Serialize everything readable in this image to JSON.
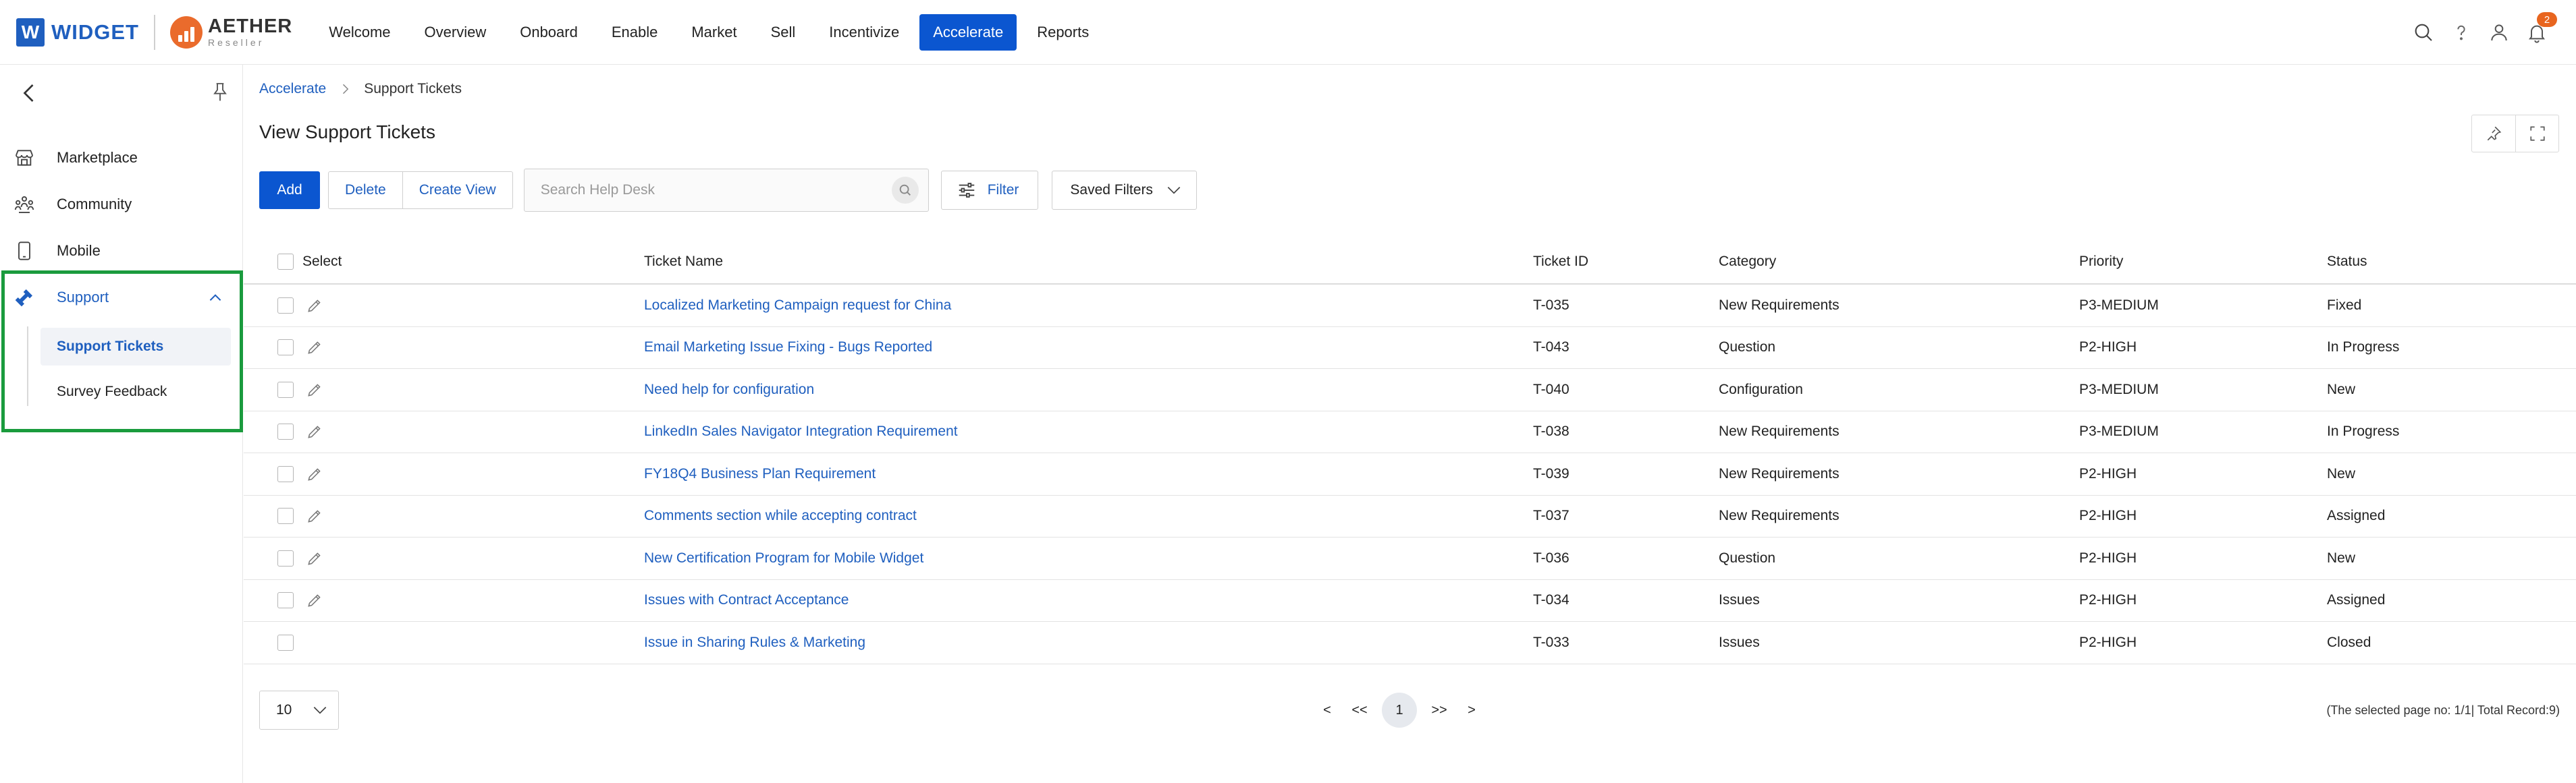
{
  "brand": {
    "widget_letter": "W",
    "widget_name": "WIDGET",
    "aether_name": "AETHER",
    "aether_sub": "Reseller"
  },
  "nav": {
    "items": [
      {
        "label": "Welcome",
        "active": false
      },
      {
        "label": "Overview",
        "active": false
      },
      {
        "label": "Onboard",
        "active": false
      },
      {
        "label": "Enable",
        "active": false
      },
      {
        "label": "Market",
        "active": false
      },
      {
        "label": "Sell",
        "active": false
      },
      {
        "label": "Incentivize",
        "active": false
      },
      {
        "label": "Accelerate",
        "active": true
      },
      {
        "label": "Reports",
        "active": false
      }
    ],
    "notification_count": "2"
  },
  "sidebar": {
    "items": [
      {
        "label": "Marketplace",
        "icon": "store-icon"
      },
      {
        "label": "Community",
        "icon": "community-icon"
      },
      {
        "label": "Mobile",
        "icon": "mobile-icon"
      },
      {
        "label": "Support",
        "icon": "support-icon"
      }
    ],
    "subitems": [
      {
        "label": "Support Tickets",
        "active": true
      },
      {
        "label": "Survey Feedback",
        "active": false
      }
    ]
  },
  "breadcrumb": {
    "parent": "Accelerate",
    "current": "Support Tickets"
  },
  "page": {
    "title": "View Support Tickets"
  },
  "toolbar": {
    "add_label": "Add",
    "delete_label": "Delete",
    "create_view_label": "Create View",
    "search_placeholder": "Search Help Desk",
    "filter_label": "Filter",
    "saved_filters_label": "Saved Filters"
  },
  "table": {
    "headers": {
      "select": "Select",
      "name": "Ticket Name",
      "id": "Ticket ID",
      "category": "Category",
      "priority": "Priority",
      "status": "Status"
    },
    "rows": [
      {
        "name": "Localized Marketing Campaign request for China",
        "id": "T-035",
        "category": "New Requirements",
        "priority": "P3-MEDIUM",
        "status": "Fixed",
        "editable": true
      },
      {
        "name": "Email Marketing Issue Fixing - Bugs Reported",
        "id": "T-043",
        "category": "Question",
        "priority": "P2-HIGH",
        "status": "In Progress",
        "editable": true
      },
      {
        "name": "Need help for configuration",
        "id": "T-040",
        "category": "Configuration",
        "priority": "P3-MEDIUM",
        "status": "New",
        "editable": true
      },
      {
        "name": "LinkedIn Sales Navigator Integration Requirement",
        "id": "T-038",
        "category": "New Requirements",
        "priority": "P3-MEDIUM",
        "status": "In Progress",
        "editable": true
      },
      {
        "name": "FY18Q4 Business Plan Requirement",
        "id": "T-039",
        "category": "New Requirements",
        "priority": "P2-HIGH",
        "status": "New",
        "editable": true
      },
      {
        "name": "Comments section while accepting contract",
        "id": "T-037",
        "category": "New Requirements",
        "priority": "P2-HIGH",
        "status": "Assigned",
        "editable": true
      },
      {
        "name": "New Certification Program for Mobile Widget",
        "id": "T-036",
        "category": "Question",
        "priority": "P2-HIGH",
        "status": "New",
        "editable": true
      },
      {
        "name": "Issues with Contract Acceptance",
        "id": "T-034",
        "category": "Issues",
        "priority": "P2-HIGH",
        "status": "Assigned",
        "editable": true
      },
      {
        "name": "Issue in Sharing Rules & Marketing",
        "id": "T-033",
        "category": "Issues",
        "priority": "P2-HIGH",
        "status": "Closed",
        "editable": false
      }
    ]
  },
  "pagination": {
    "page_size": "10",
    "prev": "<",
    "first": "<<",
    "current": "1",
    "last": ">>",
    "next": ">",
    "info": "(The selected page no: 1/1| Total Record:9)"
  },
  "colors": {
    "accent": "#0b56d0",
    "link": "#1f5fbf",
    "highlight_box": "#1a9b3d",
    "badge": "#e8651f"
  }
}
